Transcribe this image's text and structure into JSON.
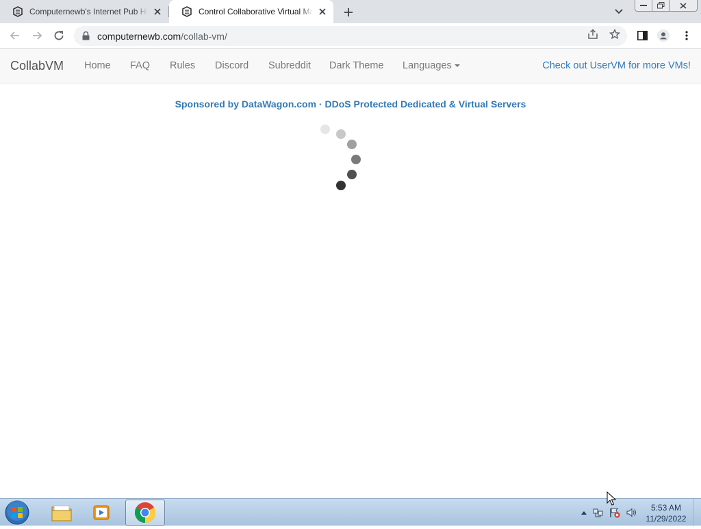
{
  "browser": {
    "tabs": [
      {
        "title": "Computernewb's Internet Pub Hu",
        "active": false,
        "favicon": "computernewb-favicon"
      },
      {
        "title": "Control Collaborative Virtual Ma",
        "active": true,
        "favicon": "computernewb-favicon"
      }
    ],
    "url_host": "computernewb.com",
    "url_path": "/collab-vm/"
  },
  "site": {
    "brand": "CollabVM",
    "nav": [
      "Home",
      "FAQ",
      "Rules",
      "Discord",
      "Subreddit",
      "Dark Theme",
      "Languages"
    ],
    "right_link": "Check out UserVM for more VMs!",
    "sponsor": "Sponsored by DataWagon.com · DDoS Protected Dedicated & Virtual Servers",
    "loading": true
  },
  "taskbar": {
    "pinned": [
      "windows-explorer-icon",
      "media-player-icon",
      "chrome-icon"
    ],
    "active_app": "chrome-icon",
    "time": "5:53 AM",
    "date": "11/29/2022"
  },
  "colors": {
    "link": "#337ab7",
    "navbar_bg": "#f8f8f8",
    "tabstrip_bg": "#dee1e6"
  }
}
